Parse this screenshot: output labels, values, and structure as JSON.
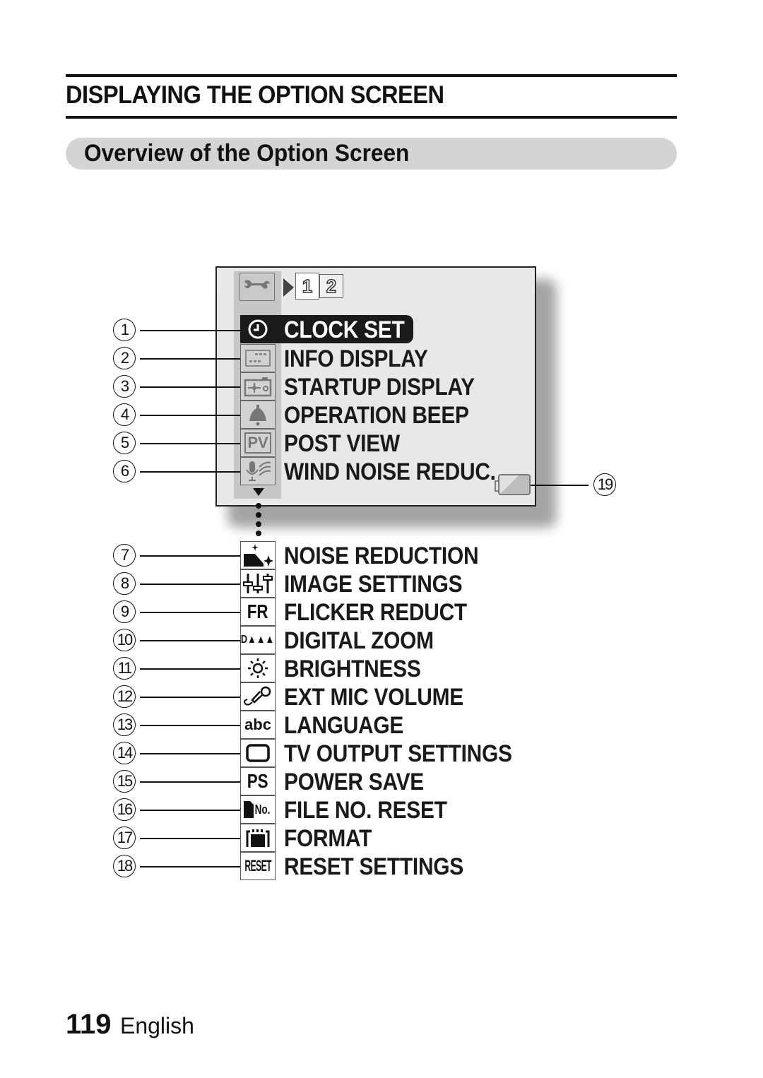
{
  "section_title": "DISPLAYING THE OPTION SCREEN",
  "subsection_title": "Overview of the Option Screen",
  "screen": {
    "tab_icon": "wrench-icon",
    "page_indicator": {
      "arrow": "play-triangle-icon",
      "pages": [
        "1",
        "2"
      ],
      "current_page": "1"
    },
    "more_indicator": "down-triangle-icon",
    "battery_callout": "19",
    "battery_icon": "battery-icon"
  },
  "menu_items": [
    {
      "callout": "1",
      "icon": "clock-icon",
      "label": "CLOCK SET",
      "selected": true
    },
    {
      "callout": "2",
      "icon": "info-display-icon",
      "label": "INFO DISPLAY"
    },
    {
      "callout": "3",
      "icon": "startup-display-icon",
      "label": "STARTUP DISPLAY"
    },
    {
      "callout": "4",
      "icon": "bell-icon",
      "label": "OPERATION BEEP"
    },
    {
      "callout": "5",
      "icon": "pv-icon",
      "label": "POST VIEW",
      "icon_text": "PV"
    },
    {
      "callout": "6",
      "icon": "wind-mic-icon",
      "label": "WIND NOISE REDUC."
    },
    {
      "callout": "7",
      "icon": "noise-reduction-icon",
      "label": "NOISE REDUCTION"
    },
    {
      "callout": "8",
      "icon": "sliders-icon",
      "label": "IMAGE SETTINGS"
    },
    {
      "callout": "9",
      "icon": "fr-icon",
      "label": "FLICKER REDUCT",
      "icon_text": "FR"
    },
    {
      "callout": "10",
      "icon": "digital-zoom-icon",
      "label": "DIGITAL ZOOM",
      "icon_text": "D▲▲▲"
    },
    {
      "callout": "11",
      "icon": "sun-icon",
      "label": "BRIGHTNESS"
    },
    {
      "callout": "12",
      "icon": "microphone-icon",
      "label": "EXT MIC VOLUME"
    },
    {
      "callout": "13",
      "icon": "abc-icon",
      "label": "LANGUAGE",
      "icon_text": "abc"
    },
    {
      "callout": "14",
      "icon": "tv-icon",
      "label": "TV OUTPUT SETTINGS"
    },
    {
      "callout": "15",
      "icon": "ps-icon",
      "label": "POWER SAVE",
      "icon_text": "PS"
    },
    {
      "callout": "16",
      "icon": "file-no-icon",
      "label": "FILE NO. RESET",
      "icon_text": "No."
    },
    {
      "callout": "17",
      "icon": "format-card-icon",
      "label": "FORMAT"
    },
    {
      "callout": "18",
      "icon": "reset-icon",
      "label": "RESET SETTINGS",
      "icon_text": "RESET"
    }
  ],
  "footer": {
    "page_number": "119",
    "language": "English"
  }
}
